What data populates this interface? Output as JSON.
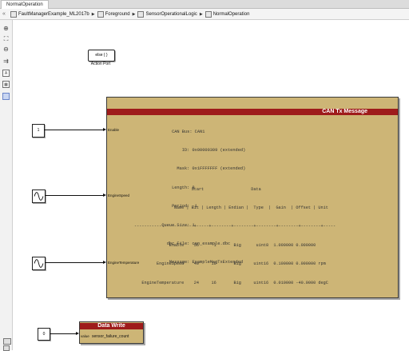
{
  "tab": {
    "label": "NormalOperation"
  },
  "breadcrumb": [
    "FaultManagerExample_ML2017b",
    "Foreground",
    "SensorOperationalLogic",
    "NormalOperation"
  ],
  "toolbar": {
    "icons": [
      "zoom-in-icon",
      "fit-view-icon",
      "zoom-out-icon",
      "arrow-icon",
      "annotation-icon",
      "grid-icon",
      "block-icon"
    ]
  },
  "action_port": {
    "block_text": "else { }",
    "label": "Action Port"
  },
  "inputs": {
    "constant_value": "1",
    "enable_port": "Enable",
    "engine_speed_port": "EngineSpeed",
    "engine_temp_port": "EngineTemperature"
  },
  "can_block": {
    "title": "CAN Tx Message",
    "info_lines": [
      "      CAN Bus: CAN1",
      "          ID: 0x00000309 (extended)",
      "        Mask: 0x1FFFFFFF (extended)",
      "      Length: 8",
      "      Period: -1",
      "  Queue Size: 1",
      "    dbc File: can_example.dbc",
      "     Message: ExampleMsgTxExtended"
    ],
    "table_lines": [
      "                       Start                   Data",
      "                Name | Bit | Length | Endian |  Type  |  Gain  | Offset | Unit",
      "------------------------+-----+--------+--------+--------+--------+--------+-----",
      "              Enable    56      1       Big      uint8  1.000000 0.000000",
      "         EngineSpeed    40     16       Big     uint16  0.100000 0.000000 rpm",
      "   EngineTemperature    24     16       Big     uint16  0.010000 -40.0000 degC"
    ]
  },
  "data_write": {
    "title": "Data Write",
    "port_label": "value",
    "variable": "sensor_failure_count",
    "input_value": "0"
  }
}
